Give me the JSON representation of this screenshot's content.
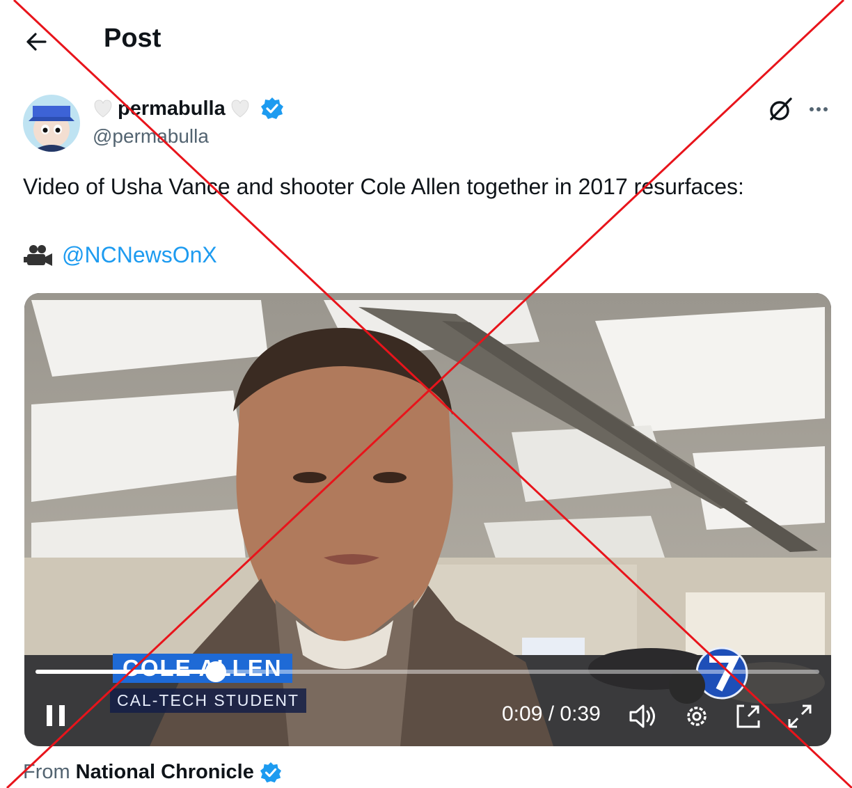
{
  "header": {
    "title": "Post"
  },
  "author": {
    "display_name": "permabulla",
    "handle": "@permabulla"
  },
  "post": {
    "text": "Video of Usha Vance and shooter Cole Allen together in 2017 resurfaces:",
    "credit_mention": "@NCNewsOnX"
  },
  "video": {
    "lower_third_name": "COLE ALLEN",
    "lower_third_title": "CAL-TECH STUDENT",
    "time_display": "0:09 / 0:39",
    "progress": 0.23
  },
  "source": {
    "prefix": "From",
    "name": "National Chronicle"
  },
  "colors": {
    "accent": "#1d9bf0",
    "overlay_cross": "#e8141b"
  },
  "icons": [
    "back-arrow-icon",
    "verified-icon",
    "grok-icon",
    "more-icon",
    "camera-icon",
    "pause-icon",
    "volume-icon",
    "settings-icon",
    "pip-icon",
    "fullscreen-icon"
  ]
}
